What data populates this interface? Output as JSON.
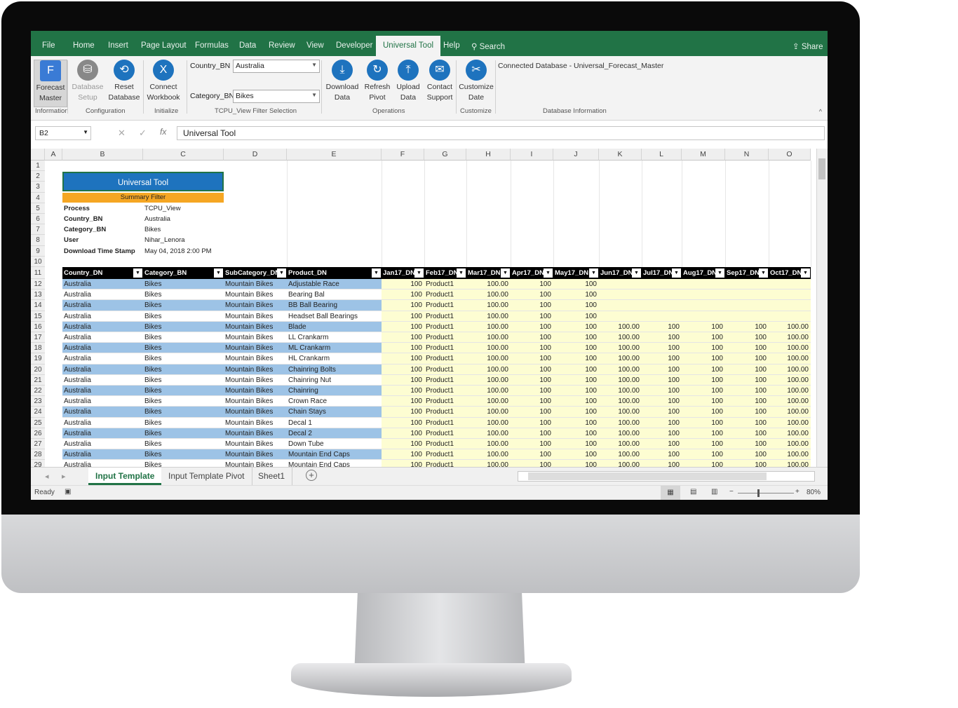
{
  "ribbon_tabs": [
    "File",
    "Home",
    "Insert",
    "Page Layout",
    "Formulas",
    "Data",
    "Review",
    "View",
    "Developer",
    "Universal Tool",
    "Help",
    "Search"
  ],
  "share_label": "Share",
  "ribbon": {
    "buttons": [
      {
        "label": "Forecast\nMaster",
        "icon": "forecast-master-icon"
      },
      {
        "label": "Database\nSetup",
        "icon": "database-icon"
      },
      {
        "label": "Reset\nDatabase",
        "icon": "reset-database-icon"
      },
      {
        "label": "Connect\nWorkbook",
        "icon": "excel-connect-icon"
      },
      {
        "label": "Download\nData",
        "icon": "download-icon"
      },
      {
        "label": "Refresh\nPivot",
        "icon": "refresh-icon"
      },
      {
        "label": "Upload\nData",
        "icon": "upload-icon"
      },
      {
        "label": "Contact\nSupport",
        "icon": "mail-icon"
      },
      {
        "label": "Customize\nDate",
        "icon": "tools-icon"
      }
    ],
    "groups": [
      "Information",
      "Configuration",
      "Initialize",
      "TCPU_View Filter Selection",
      "Operations",
      "Customize",
      "Database Information"
    ],
    "filter_country_label": "Country_BN",
    "filter_country_value": "Australia",
    "filter_category_label": "Category_BN",
    "filter_category_value": "Bikes",
    "db_info": "Connected Database - Universal_Forecast_Master"
  },
  "formula_bar": {
    "name_box": "B2",
    "formula": "Universal Tool"
  },
  "columns": [
    "A",
    "B",
    "C",
    "D",
    "E",
    "F",
    "G",
    "H",
    "I",
    "J",
    "K",
    "L",
    "M",
    "N",
    "O"
  ],
  "summary": {
    "title": "Universal Tool",
    "subtitle": "Summary Filter",
    "rows": [
      [
        "Process",
        "TCPU_View"
      ],
      [
        "Country_BN",
        "Australia"
      ],
      [
        "Category_BN",
        "Bikes"
      ],
      [
        "User",
        "Nihar_Lenora"
      ],
      [
        "Download Time Stamp",
        "May 04, 2018 2:00 PM"
      ]
    ]
  },
  "table_headers": [
    "Country_DN",
    "Category_BN",
    "SubCategory_DN",
    "Product_DN",
    "Jan17_DN",
    "Feb17_DN",
    "Mar17_DN",
    "Apr17_DN",
    "May17_DN",
    "Jun17_DN",
    "Jul17_DN",
    "Aug17_DN",
    "Sep17_DN",
    "Oct17_DN"
  ],
  "products": [
    "Adjustable Race",
    "Bearing Bal",
    "BB Ball Bearing",
    "Headset Ball Bearings",
    "Blade",
    "LL Crankarm",
    "ML Crankarm",
    "HL Crankarm",
    "Chainring Bolts",
    "Chainring Nut",
    "Chainring",
    "Crown Race",
    "Chain Stays",
    "Decal 1",
    "Decal 2",
    "Down Tube",
    "Mountain End Caps",
    "Mountain End Caps"
  ],
  "row_common": {
    "country": "Australia",
    "category": "Bikes",
    "subcategory": "Mountain Bikes",
    "jan": "100",
    "feb": "Product1",
    "mar": "100.00",
    "apr": "100",
    "may": "100",
    "jun": "100.00",
    "jul": "100",
    "aug": "100",
    "sep": "100",
    "oct": "100.00"
  },
  "sheet_tabs": [
    "Input Template",
    "Input Template Pivot",
    "Sheet1"
  ],
  "status": {
    "ready": "Ready",
    "zoom": "80%"
  }
}
